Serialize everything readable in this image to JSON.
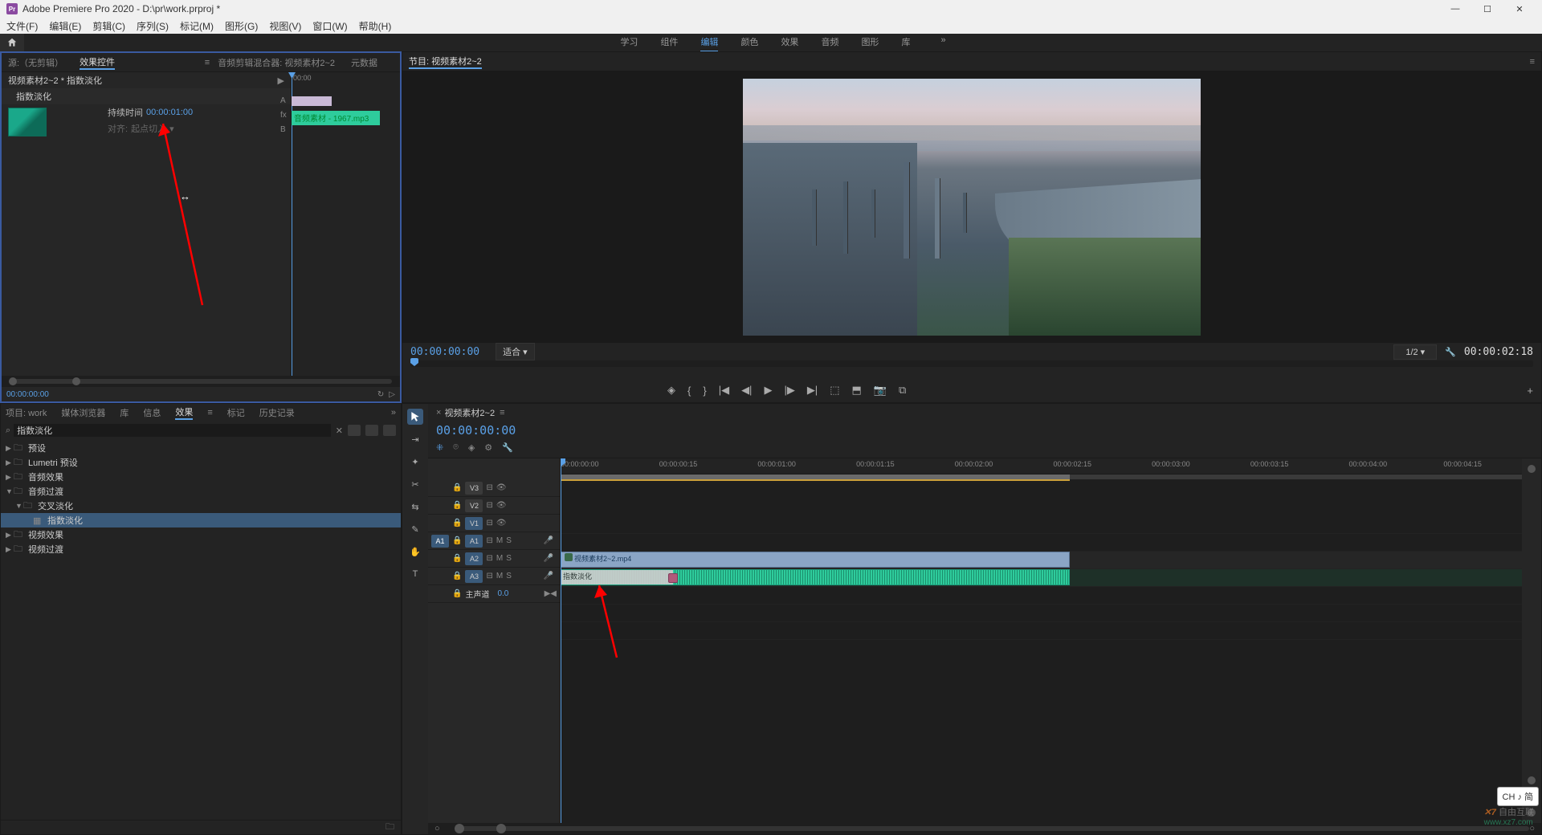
{
  "titlebar": {
    "app_name": "Adobe Premiere Pro 2020",
    "project_path": "D:\\pr\\work.prproj *"
  },
  "menubar": {
    "items": [
      "文件(F)",
      "编辑(E)",
      "剪辑(C)",
      "序列(S)",
      "标记(M)",
      "图形(G)",
      "视图(V)",
      "窗口(W)",
      "帮助(H)"
    ]
  },
  "workspace_tabs": {
    "items": [
      "学习",
      "组件",
      "编辑",
      "颜色",
      "效果",
      "音频",
      "图形",
      "库"
    ],
    "active_index": 2,
    "more": "»"
  },
  "effect_controls": {
    "tabs": [
      "源:（无剪辑）",
      "效果控件",
      "音频剪辑混合器: 视频素材2~2",
      "元数据"
    ],
    "active_tab": 1,
    "clip_name": "视频素材2~2 * 指数淡化",
    "time_header": "00:00",
    "effect_label": "指数淡化",
    "duration_label": "持续时间",
    "duration_value": "00:00:01:00",
    "align_label": "对齐:",
    "align_value": "起点切入",
    "track_a_label": "A",
    "track_b_label": "B",
    "track_gray_label": "fx",
    "clip_b_label": "音频素材 - 1967.mp3",
    "footer_time": "00:00:00:00"
  },
  "program": {
    "panel_label": "节目: 视频素材2~2",
    "timecode": "00:00:00:00",
    "fit_label": "适合",
    "ratio_label": "1/2",
    "duration": "00:00:02:18"
  },
  "transport": {
    "icons": [
      "marker",
      "in-out",
      "center",
      "prev",
      "back",
      "play",
      "fwd",
      "next",
      "in",
      "out",
      "export",
      "camera",
      "grid",
      "plus"
    ]
  },
  "projects": {
    "tabs": [
      "项目: work",
      "媒体浏览器",
      "库",
      "信息",
      "效果",
      "标记",
      "历史记录"
    ],
    "active_tab": 4,
    "search_value": "指数淡化",
    "tree": [
      {
        "level": 0,
        "arrow": "▶",
        "icon": "folder",
        "label": "预设"
      },
      {
        "level": 0,
        "arrow": "▶",
        "icon": "folder",
        "label": "Lumetri 预设"
      },
      {
        "level": 0,
        "arrow": "▶",
        "icon": "folder",
        "label": "音频效果"
      },
      {
        "level": 0,
        "arrow": "▼",
        "icon": "folder",
        "label": "音频过渡"
      },
      {
        "level": 1,
        "arrow": "▼",
        "icon": "folder",
        "label": "交叉淡化"
      },
      {
        "level": 2,
        "arrow": "",
        "icon": "fx",
        "label": "指数淡化",
        "selected": true
      },
      {
        "level": 0,
        "arrow": "▶",
        "icon": "folder",
        "label": "视频效果"
      },
      {
        "level": 0,
        "arrow": "▶",
        "icon": "folder",
        "label": "视频过渡"
      }
    ]
  },
  "timeline": {
    "panel_title": "视频素材2~2",
    "timecode": "00:00:00:00",
    "ruler_ticks": [
      {
        "pos": 0,
        "label": "00:00:00:00"
      },
      {
        "pos": 12.5,
        "label": "00:00:00:15"
      },
      {
        "pos": 25,
        "label": "00:00:01:00"
      },
      {
        "pos": 37.5,
        "label": "00:00:01:15"
      },
      {
        "pos": 50,
        "label": "00:00:02:00"
      },
      {
        "pos": 62.5,
        "label": "00:00:02:15"
      },
      {
        "pos": 75,
        "label": "00:00:03:00"
      },
      {
        "pos": 87.5,
        "label": "00:00:03:15"
      },
      {
        "pos": 100,
        "label": "00:00:04:00"
      },
      {
        "pos": 112,
        "label": "00:00:04:15"
      }
    ],
    "tracks": {
      "v3": "V3",
      "v2": "V2",
      "v1": "V1",
      "a1": "A1",
      "a2": "A2",
      "a3": "A3",
      "master": "主声道",
      "master_val": "0.0"
    },
    "source_a1": "A1",
    "btn_m": "M",
    "btn_s": "S",
    "video_clip_label": "视频素材2~2.mp4",
    "audio_fade_label": "指数淡化"
  },
  "ime": "CH ♪ 简",
  "watermark": {
    "top": "自由互联",
    "bottom": "www.xz7.com"
  }
}
